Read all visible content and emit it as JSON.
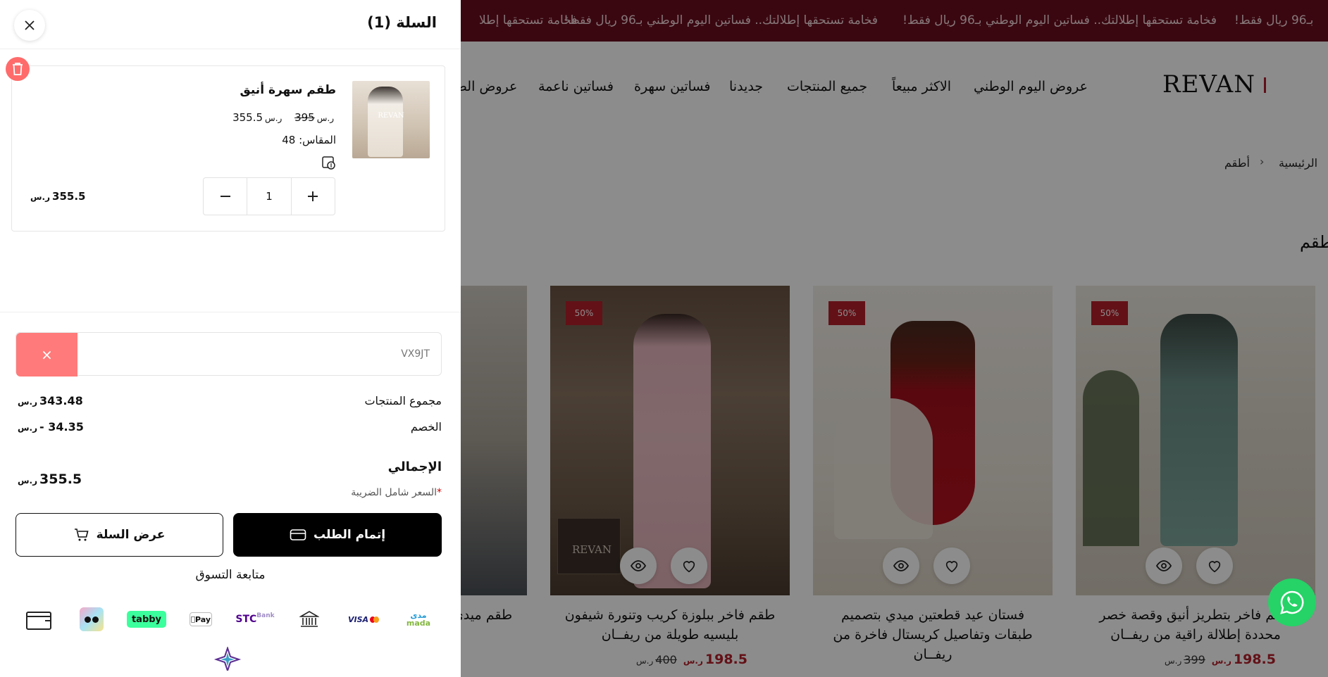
{
  "ticker": {
    "text_1": "فخامة تستحقها إطلالتك.. فساتين اليوم الوطني بـ96 ريال فقط!",
    "text_2": "فخامة تستحقها إطلالتك.. فساتين اليوم الوطني بـ96 ريال فقط!",
    "text_3": "بـ96 ريال فقط!",
    "text_4": "فخامة تستحقها إطلا"
  },
  "header": {
    "logo": "REVAN",
    "nav": [
      "عروض اليوم الوطني",
      "الاكثر مبيعاً",
      "جميع المنتجات",
      "جديدنا",
      "فساتين سهرة",
      "فساتين ناعمة",
      "عروض الص"
    ]
  },
  "breadcrumb": {
    "home": "الرئيسية",
    "separator": "›",
    "current": "أطقم"
  },
  "page_title": "أطقم",
  "products": [
    {
      "badge": "50%",
      "title_line1": "طقم فاخر بتطريز أنيق وقصة خصر",
      "title_line2": "محددة إطلالة راقية من ريفــان",
      "price": "198.5",
      "old_price": "399"
    },
    {
      "badge": "50%",
      "title_line1": "فستان عيد قطعتين ميدي بتصميم",
      "title_line2": "طبقات وتفاصيل كريستال فاخرة من",
      "title_line3": "ريفــان",
      "price": "",
      "old_price": ""
    },
    {
      "badge": "50%",
      "title_line1": "طقم فاخر ببلوزة كريب وتنورة شيفون",
      "title_line2": "بليسيه طويلة من ريفــان",
      "price": "198.5",
      "old_price": "400",
      "watermark": "REVAN"
    },
    {
      "title_line1": "طقم ميدي"
    }
  ],
  "cart": {
    "title": "السلة (1)",
    "item": {
      "name": "طقم سهرة أنيق",
      "price": "355.5",
      "old_price": "395",
      "size_label": "المقاس: 48",
      "quantity": "1",
      "line_total": "355.5",
      "thumb_text": "REVAN"
    },
    "coupon": {
      "code": "VX9JT",
      "clear": "×"
    },
    "summary": {
      "subtotal_label": "مجموع المنتجات",
      "subtotal_value": "343.48",
      "discount_label": "الخصم",
      "discount_value": "- 34.35",
      "total_label": "الإجمالي",
      "total_value": "355.5",
      "tax_note": "السعر شامل الضريبة",
      "tax_star": "*"
    },
    "checkout_label": "إتمام الطلب",
    "view_cart_label": "عرض السلة",
    "continue_label": "متابعة التسوق",
    "payment": {
      "mada": "mada",
      "mada_ar": "مدى",
      "visa": "VISA",
      "stc": "STC",
      "stc_bank": "Bank",
      "apple": "Pay",
      "tabby": "tabby"
    }
  },
  "colors": {
    "brand": "#6b0d1e",
    "sale": "#b41f2a",
    "trash": "#ff6b6b",
    "whatsapp": "#25d366"
  }
}
